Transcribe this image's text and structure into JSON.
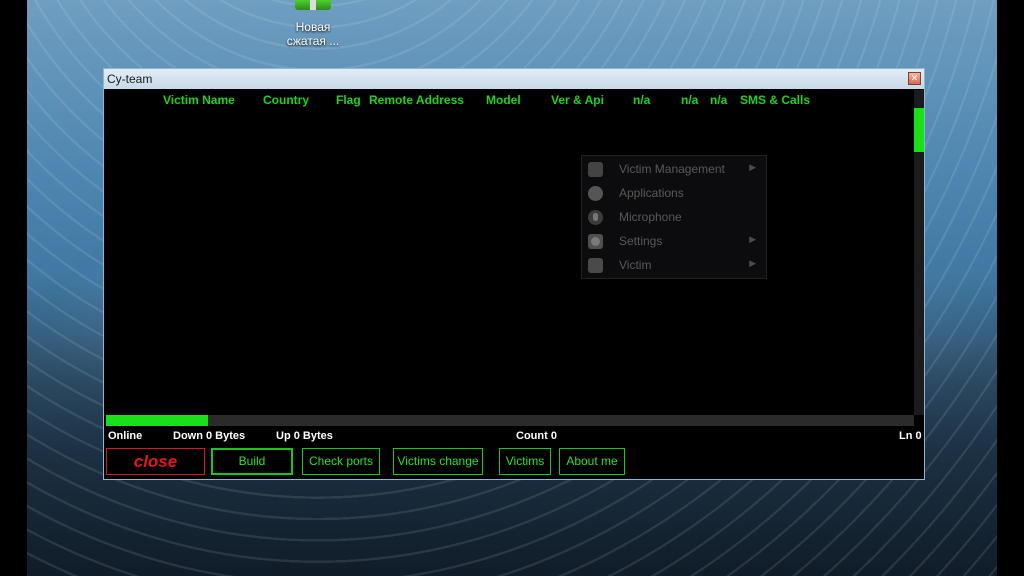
{
  "desktop": {
    "icon": {
      "name": "archive-icon",
      "label": "Новая сжатая ..."
    }
  },
  "window": {
    "title": "Cy-team",
    "columns": [
      "Victim Name",
      "Country",
      "Flag",
      "Remote Address",
      "Model",
      "Ver & Api",
      "n/a",
      "n/a",
      "n/a",
      "SMS & Calls"
    ]
  },
  "context_menu": {
    "items": [
      {
        "label": "Victim Management",
        "icon": "square-icon",
        "submenu": true
      },
      {
        "label": "Applications",
        "icon": "apps-icon",
        "submenu": false
      },
      {
        "label": "Microphone",
        "icon": "microphone-icon",
        "submenu": false
      },
      {
        "label": "Settings",
        "icon": "gear-icon",
        "submenu": true
      },
      {
        "label": "Victim",
        "icon": "person-icon",
        "submenu": true
      }
    ]
  },
  "status": {
    "online": "Online",
    "down": "Down 0 Bytes",
    "up": "Up 0 Bytes",
    "count": "Count 0",
    "ln": "Ln 0"
  },
  "buttons": {
    "close": "close",
    "build": "Build",
    "check_ports": "Check ports",
    "victims_change": "Victims change",
    "victims": "Victims",
    "about_me": "About me"
  },
  "colors": {
    "accent_green": "#19e019",
    "close_red": "#e3161a"
  }
}
